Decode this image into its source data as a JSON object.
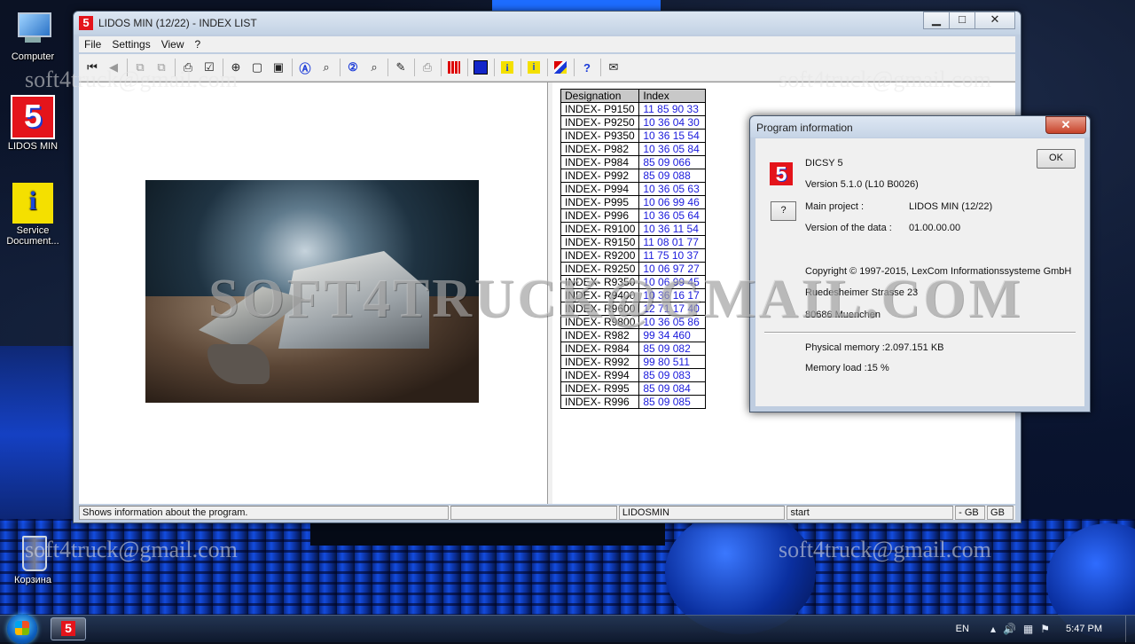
{
  "desktop": {
    "icons": [
      {
        "label": "Computer"
      },
      {
        "label": "LIDOS MIN"
      },
      {
        "label": "Service Document..."
      },
      {
        "label": "Корзина"
      }
    ],
    "watermark_small": "soft4truck@gmail.com",
    "watermark_big": "SOFT4TRUCK@GMAIL.COM"
  },
  "window": {
    "title": "LIDOS MIN (12/22) - INDEX LIST",
    "app_icon_glyph": "5",
    "menu": [
      "File",
      "Settings",
      "View",
      "?"
    ],
    "buttons": {
      "minimize": "▁",
      "maximize": "□",
      "close": "✕"
    }
  },
  "toolbar": {
    "icons": [
      "first-page-icon",
      "back-icon",
      "nav-prev-icon",
      "nav-next-icon",
      "print-setup-icon",
      "checklist-icon",
      "zoom-in-icon",
      "page-icon",
      "page-copy-icon",
      "search-a-icon",
      "search-a-alt-icon",
      "search-2-icon",
      "search-2-alt-icon",
      "edit-icon",
      "printer-icon",
      "grid-red-icon",
      "grid-blue-icon",
      "info-icon",
      "service-icon",
      "flags-icon",
      "help-query-icon",
      "mail-icon"
    ]
  },
  "index_table": {
    "headers": [
      "Designation",
      "Index"
    ],
    "rows": [
      [
        "INDEX- P9150",
        "11 85 90 33"
      ],
      [
        "INDEX- P9250",
        "10 36 04 30"
      ],
      [
        "INDEX- P9350",
        "10 36 15 54"
      ],
      [
        "INDEX- P982",
        "10 36 05 84"
      ],
      [
        "INDEX- P984",
        "85 09 066"
      ],
      [
        "INDEX- P992",
        "85 09 088"
      ],
      [
        "INDEX- P994",
        "10 36 05 63"
      ],
      [
        "INDEX- P995",
        "10 06 99 46"
      ],
      [
        "INDEX- P996",
        "10 36 05 64"
      ],
      [
        "INDEX- R9100",
        "10 36 11 54"
      ],
      [
        "INDEX- R9150",
        "11 08 01 77"
      ],
      [
        "INDEX- R9200",
        "11 75 10 37"
      ],
      [
        "INDEX- R9250",
        "10 06 97 27"
      ],
      [
        "INDEX- R9350",
        "10 06 99 45"
      ],
      [
        "INDEX- R9400",
        "10 36 16 17"
      ],
      [
        "INDEX- R9600",
        "12 71 17 40"
      ],
      [
        "INDEX- R9800",
        "10 36 05 86"
      ],
      [
        "INDEX- R982",
        "99 34 460"
      ],
      [
        "INDEX- R984",
        "85 09 082"
      ],
      [
        "INDEX- R992",
        "99 80 511"
      ],
      [
        "INDEX- R994",
        "85 09 083"
      ],
      [
        "INDEX- R995",
        "85 09 084"
      ],
      [
        "INDEX- R996",
        "85 09 085"
      ]
    ]
  },
  "statusbar": {
    "message": "Shows information about the program.",
    "panel2": "",
    "project": "LIDOSMIN",
    "state": "start",
    "lang1": "- GB",
    "lang2": "GB"
  },
  "dialog": {
    "title": "Program information",
    "close": "✕",
    "ok_label": "OK",
    "help_label": "?",
    "product": "DICSY 5",
    "version": "Version 5.1.0   (L10 B0026)",
    "main_project_label": "Main project :",
    "main_project_value": "LIDOS MIN (12/22)",
    "data_version_label": "Version of the data :",
    "data_version_value": "01.00.00.00",
    "copyright": "Copyright © 1997-2015, LexCom Informationssysteme GmbH",
    "street": "Ruedesheimer Strasse 23",
    "city": "80686 Muenchen",
    "physical_memory": "Physical memory :2.097.151 KB",
    "memory_load": "Memory load :15 %"
  },
  "taskbar": {
    "task_glyph": "5",
    "lang": "EN",
    "time": "5:47 PM"
  }
}
